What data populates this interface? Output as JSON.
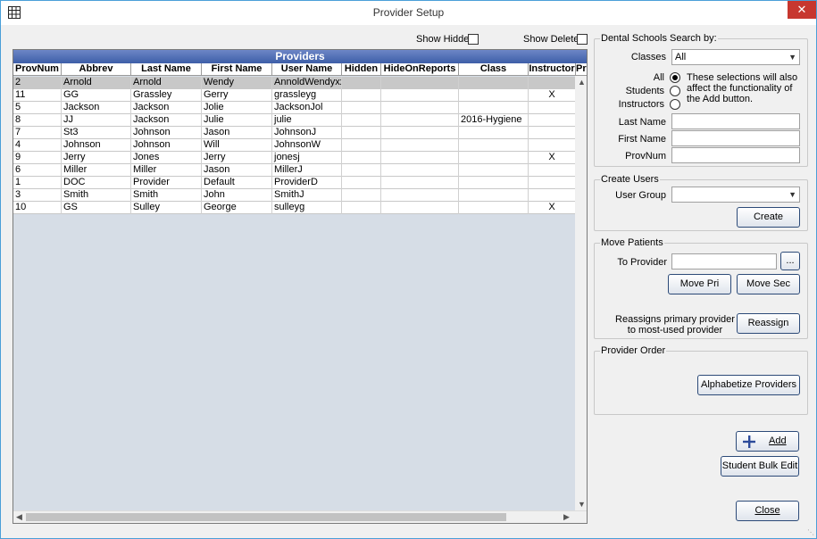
{
  "window": {
    "title": "Provider Setup",
    "close_glyph": "✕"
  },
  "filters": {
    "show_hidden": "Show Hidden",
    "show_deleted": "Show Deleted"
  },
  "grid": {
    "title": "Providers",
    "columns": [
      "ProvNum",
      "Abbrev",
      "Last Name",
      "First Name",
      "User Name",
      "Hidden",
      "HideOnReports",
      "Class",
      "Instructor",
      "Pr"
    ],
    "rows": [
      [
        "2",
        "Arnold",
        "Arnold",
        "Wendy",
        "AnnoldWendyxx",
        "",
        "",
        "",
        "",
        ""
      ],
      [
        "11",
        "GG",
        "Grassley",
        "Gerry",
        "grassleyg",
        "",
        "",
        "",
        "X",
        ""
      ],
      [
        "5",
        "Jackson",
        "Jackson",
        "Jolie",
        "JacksonJol",
        "",
        "",
        "",
        "",
        ""
      ],
      [
        "8",
        "JJ",
        "Jackson",
        "Julie",
        "julie",
        "",
        "",
        "2016-Hygiene",
        "",
        ""
      ],
      [
        "7",
        "St3",
        "Johnson",
        "Jason",
        "JohnsonJ",
        "",
        "",
        "",
        "",
        ""
      ],
      [
        "4",
        "Johnson",
        "Johnson",
        "Will",
        "JohnsonW",
        "",
        "",
        "",
        "",
        ""
      ],
      [
        "9",
        "Jerry",
        "Jones",
        "Jerry",
        "jonesj",
        "",
        "",
        "",
        "X",
        ""
      ],
      [
        "6",
        "Miller",
        "Miller",
        "Jason",
        "MillerJ",
        "",
        "",
        "",
        "",
        ""
      ],
      [
        "1",
        "DOC",
        "Provider",
        "Default",
        "ProviderD",
        "",
        "",
        "",
        "",
        ""
      ],
      [
        "3",
        "Smith",
        "Smith",
        "John",
        "SmithJ",
        "",
        "",
        "",
        "",
        ""
      ],
      [
        "10",
        "GS",
        "Sulley",
        "George",
        "sulleyg",
        "",
        "",
        "",
        "X",
        ""
      ]
    ]
  },
  "dental_search": {
    "title": "Dental Schools Search by:",
    "classes_label": "Classes",
    "classes_value": "All",
    "radio_all": "All",
    "radio_students": "Students",
    "radio_instructors": "Instructors",
    "radio_note": "These selections will also affect the functionality of the Add button.",
    "last_name_label": "Last Name",
    "first_name_label": "First Name",
    "provnum_label": "ProvNum"
  },
  "create_users": {
    "title": "Create Users",
    "user_group_label": "User Group",
    "user_group_value": "",
    "create_button": "Create"
  },
  "move_patients": {
    "title": "Move Patients",
    "to_provider_label": "To Provider",
    "browse_button": "...",
    "move_pri_button": "Move Pri",
    "move_sec_button": "Move Sec",
    "reassign_note": "Reassigns primary provider to most-used provider",
    "reassign_button": "Reassign"
  },
  "provider_order": {
    "title": "Provider Order",
    "alphabetize_button": "Alphabetize Providers"
  },
  "actions": {
    "add_button": "Add",
    "bulk_edit_button": "Student Bulk Edit",
    "close_button": "Close"
  }
}
